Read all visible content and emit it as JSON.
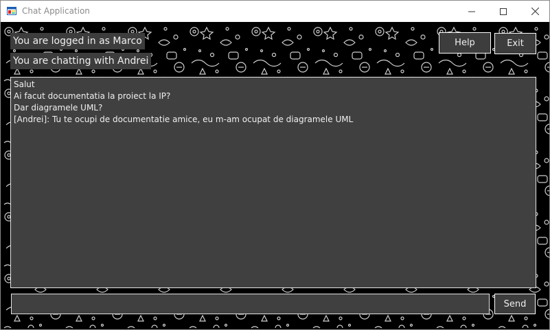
{
  "window": {
    "title": "Chat Application"
  },
  "status": {
    "logged_in": "You are logged in as Marco",
    "chatting_with": "You are chatting with Andrei"
  },
  "toolbar": {
    "help_label": "Help",
    "exit_label": "Exit"
  },
  "messages": [
    {
      "text": "Salut"
    },
    {
      "text": "Ai facut documentatia la proiect la IP?"
    },
    {
      "text": "Dar diagramele UML?"
    },
    {
      "text": "[Andrei]: Tu te ocupi de documentatie amice, eu m-am ocupat de diagramele UML"
    }
  ],
  "composer": {
    "value": "",
    "send_label": "Send"
  },
  "icons": {
    "app": "app-window-icon",
    "minimize": "minimize-icon",
    "maximize": "maximize-icon",
    "close": "close-icon"
  },
  "colors": {
    "background": "#000000",
    "panel": "#404040",
    "label_bg": "#3d3d3d",
    "text": "#f0f0f0",
    "border": "#ffffff"
  }
}
